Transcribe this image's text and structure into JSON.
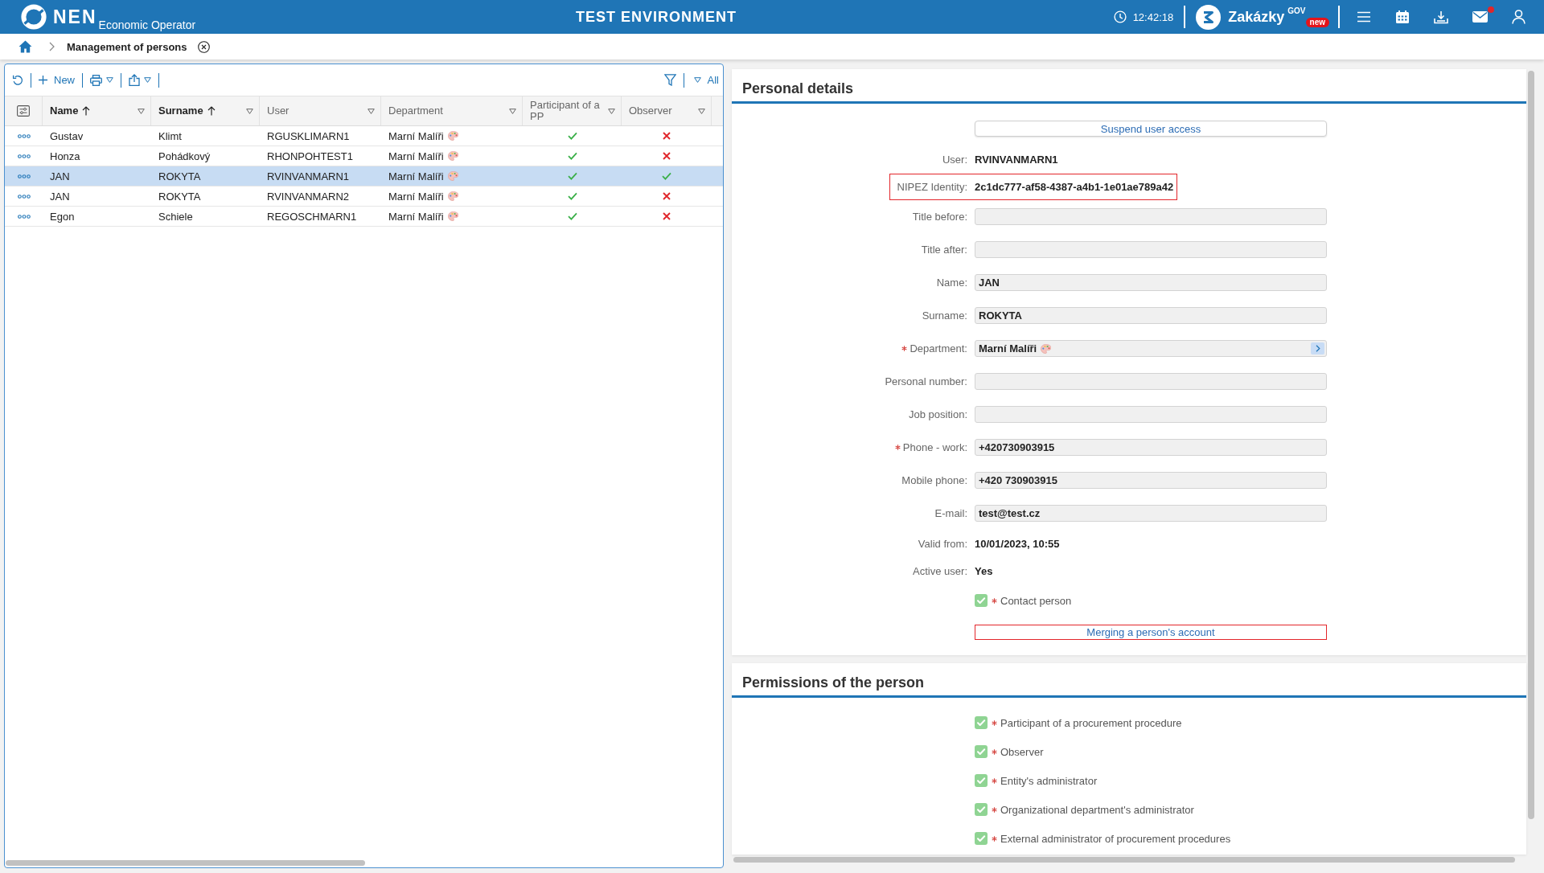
{
  "header": {
    "logo": "NEN",
    "subtitle": "Economic Operator",
    "environment": "TEST ENVIRONMENT",
    "time": "12:42:18",
    "brand": "Zakázky",
    "brand_superscript": "GOV",
    "brand_badge": "new",
    "mail_unread": true
  },
  "breadcrumb": {
    "current": "Management of persons"
  },
  "toolbar": {
    "new_button": "New",
    "filter_button": "All"
  },
  "table": {
    "columns": [
      {
        "label": "Name",
        "sorted": true
      },
      {
        "label": "Surname",
        "sorted": true
      },
      {
        "label": "User",
        "sorted": false
      },
      {
        "label": "Department",
        "sorted": false
      },
      {
        "label": "Participant of a PP",
        "sorted": false
      },
      {
        "label": "Observer",
        "sorted": false
      }
    ],
    "rows": [
      {
        "name": "Gustav",
        "surname": "Klimt",
        "user": "RGUSKLIMARN1",
        "department": "Marní Malíři",
        "participant": true,
        "observer": false,
        "selected": false
      },
      {
        "name": "Honza",
        "surname": "Pohádkový",
        "user": "RHONPOHTEST1",
        "department": "Marní Malíři",
        "participant": true,
        "observer": false,
        "selected": false
      },
      {
        "name": "JAN",
        "surname": "ROKYTA",
        "user": "RVINVANMARN1",
        "department": "Marní Malíři",
        "participant": true,
        "observer": true,
        "selected": true
      },
      {
        "name": "JAN",
        "surname": "ROKYTA",
        "user": "RVINVANMARN2",
        "department": "Marní Malíři",
        "participant": true,
        "observer": false,
        "selected": false
      },
      {
        "name": "Egon",
        "surname": "Schiele",
        "user": "REGOSCHMARN1",
        "department": "Marní Malíři",
        "participant": true,
        "observer": false,
        "selected": false
      }
    ]
  },
  "personal_details": {
    "title": "Personal details",
    "suspend_button": "Suspend user access",
    "fields": [
      {
        "kind": "text",
        "label": "User:",
        "value": "RVINVANMARN1",
        "required": false,
        "highlighted": false
      },
      {
        "kind": "text",
        "label": "NIPEZ Identity:",
        "value": "2c1dc777-af58-4387-a4b1-1e01ae789a42",
        "required": false,
        "highlighted": true
      },
      {
        "kind": "input",
        "label": "Title before:",
        "required": false,
        "highlighted": false
      },
      {
        "kind": "input",
        "label": "Title after:",
        "required": false,
        "highlighted": false
      },
      {
        "kind": "input",
        "label": "Name:",
        "value": "JAN",
        "required": false,
        "highlighted": false
      },
      {
        "kind": "input",
        "label": "Surname:",
        "value": "ROKYTA",
        "required": false,
        "highlighted": false
      },
      {
        "kind": "select",
        "label": "Department:",
        "value": "Marní Malíři",
        "required": true,
        "highlighted": false
      },
      {
        "kind": "input",
        "label": "Personal number:",
        "required": false,
        "highlighted": false
      },
      {
        "kind": "input",
        "label": "Job position:",
        "required": false,
        "highlighted": false
      },
      {
        "kind": "input",
        "label": "Phone - work:",
        "value": "+420730903915",
        "required": true,
        "highlighted": false
      },
      {
        "kind": "input",
        "label": "Mobile phone:",
        "value": "+420 730903915",
        "required": false,
        "highlighted": false
      },
      {
        "kind": "input",
        "label": "E-mail:",
        "value": "test@test.cz",
        "required": false,
        "highlighted": false
      },
      {
        "kind": "text",
        "label": "Valid from:",
        "value": "10/01/2023, 10:55",
        "required": false,
        "highlighted": false
      },
      {
        "kind": "text",
        "label": "Active user:",
        "value": "Yes",
        "required": false,
        "highlighted": false
      }
    ],
    "contact_person": {
      "label": "Contact person",
      "required": true,
      "checked": true
    },
    "merge_button": {
      "label": "Merging a person's account",
      "highlighted": true
    }
  },
  "permissions": {
    "title": "Permissions of the person",
    "items": [
      {
        "label": "Participant of a procurement procedure",
        "required": true,
        "checked": true
      },
      {
        "label": "Observer",
        "required": true,
        "checked": true
      },
      {
        "label": "Entity's administrator",
        "required": true,
        "checked": true
      },
      {
        "label": "Organizational department's administrator",
        "required": true,
        "checked": true
      },
      {
        "label": "External administrator of procurement procedures",
        "required": true,
        "checked": true
      }
    ]
  }
}
